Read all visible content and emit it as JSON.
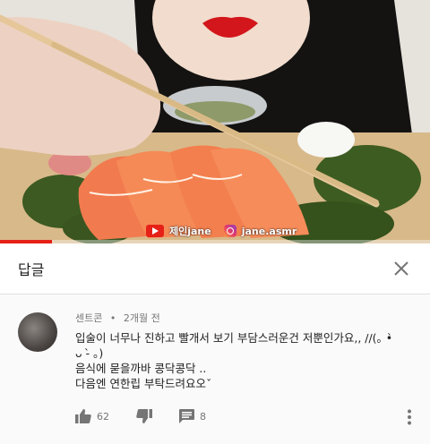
{
  "video": {
    "watermark_channel": "제인jane",
    "watermark_instagram": "jane.asmr",
    "progress_fraction": 0.12,
    "accent_color": "#e62117"
  },
  "header": {
    "title": "답글",
    "close_icon": "close-icon"
  },
  "comment": {
    "author": "센트콘",
    "separator": "•",
    "time": "2개월 전",
    "lines": [
      "입술이 너무나 진하고 빨개서 보기 부담스러운건 저뿐인가요,, //(｡ •̀",
      "ᴗ -̀ ｡)",
      "음식에 묻을까바 콩닥콩닥 ..",
      "다음엔 연한립 부탁드려요오ˇ"
    ],
    "like_count": "62",
    "reply_count": "8"
  },
  "icons": {
    "like": "thumb-up-icon",
    "dislike": "thumb-down-icon",
    "reply": "reply-icon",
    "more": "more-vert-icon"
  }
}
